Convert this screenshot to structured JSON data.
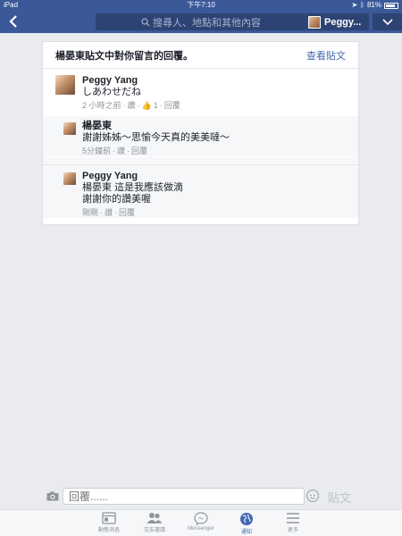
{
  "status_bar": {
    "device": "iPad",
    "time": "下午7:10",
    "battery": "81%",
    "battery_level": 0.81
  },
  "nav": {
    "search_placeholder": "搜尋人、地點和其他內容",
    "profile_name": "Peggy..."
  },
  "card": {
    "title": "楊晏東貼文中對你留言的回覆。",
    "view_post": "查看貼文"
  },
  "comments": [
    {
      "name": "Peggy Yang",
      "text": "しあわせだね",
      "time": "2 小時之前",
      "like": "讚",
      "like_count": "1",
      "reply": "回覆"
    },
    {
      "name": "楊晏東",
      "text": "謝謝姊姊～思愉今天真的美美噠～",
      "time": "5分鐘前",
      "like": "讚",
      "reply": "回覆"
    },
    {
      "name": "Peggy Yang",
      "text_line1": "楊晏東 這是我應該做滴",
      "text_line2": "謝謝你的讚美喔",
      "time": "剛剛",
      "like": "讚",
      "reply": "回覆"
    }
  ],
  "composer": {
    "placeholder": "回覆......",
    "post_label": "貼文"
  },
  "tabs": [
    {
      "label": "動態消息",
      "icon": "news-feed-icon"
    },
    {
      "label": "交友邀請",
      "icon": "friend-requests-icon"
    },
    {
      "label": "Messenger",
      "icon": "messenger-icon"
    },
    {
      "label": "通知",
      "icon": "notifications-globe-icon",
      "active": true
    },
    {
      "label": "更多",
      "icon": "more-menu-icon"
    }
  ],
  "colors": {
    "brand": "#3b5998",
    "link": "#4267b2",
    "meta": "#90949c"
  }
}
